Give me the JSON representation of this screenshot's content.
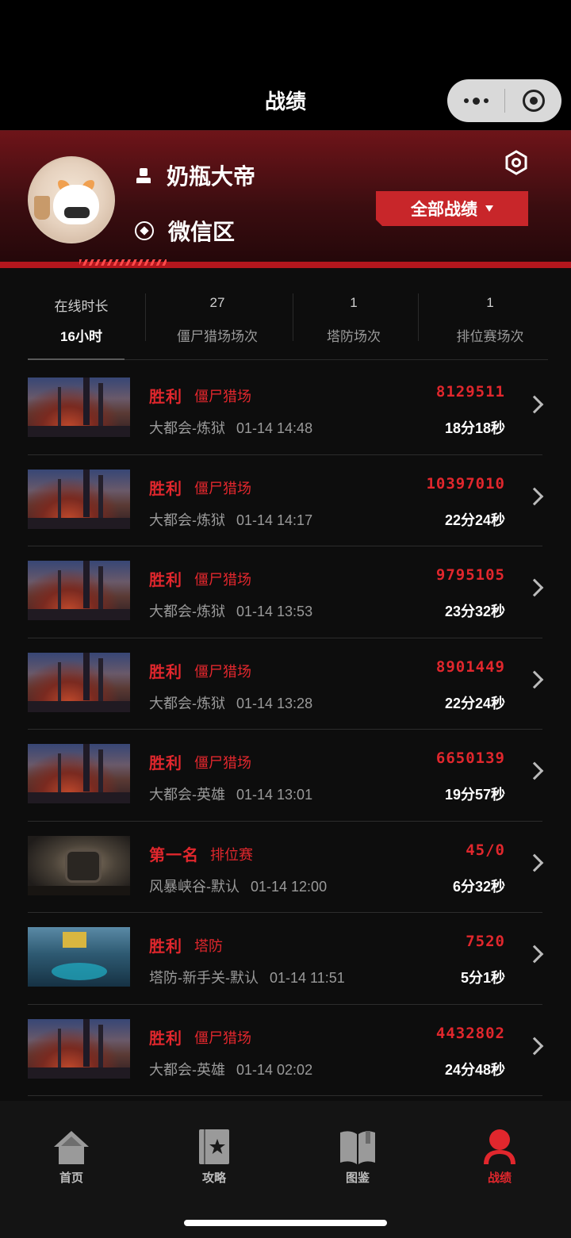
{
  "nav": {
    "title": "战绩",
    "more_icon": "more-dots-icon",
    "close_icon": "mini-program-close-icon"
  },
  "profile": {
    "name": "奶瓶大帝",
    "zone": "微信区",
    "user_icon": "user-icon",
    "zone_icon": "target-icon",
    "settings_icon": "hexagon-settings-icon",
    "filter_label": "全部战绩"
  },
  "stats": [
    {
      "top": "在线时长",
      "bottom": "16小时"
    },
    {
      "top": "27",
      "bottom": "僵尸猎场场次"
    },
    {
      "top": "1",
      "bottom": "塔防场次"
    },
    {
      "top": "1",
      "bottom": "排位赛场次"
    }
  ],
  "matches": [
    {
      "result": "胜利",
      "mode": "僵尸猎场",
      "map": "大都会-炼狱",
      "time": "01-14 14:48",
      "score": "8129511",
      "duration": "18分18秒",
      "thumb": "city"
    },
    {
      "result": "胜利",
      "mode": "僵尸猎场",
      "map": "大都会-炼狱",
      "time": "01-14 14:17",
      "score": "10397010",
      "duration": "22分24秒",
      "thumb": "city"
    },
    {
      "result": "胜利",
      "mode": "僵尸猎场",
      "map": "大都会-炼狱",
      "time": "01-14 13:53",
      "score": "9795105",
      "duration": "23分32秒",
      "thumb": "city"
    },
    {
      "result": "胜利",
      "mode": "僵尸猎场",
      "map": "大都会-炼狱",
      "time": "01-14 13:28",
      "score": "8901449",
      "duration": "22分24秒",
      "thumb": "city"
    },
    {
      "result": "胜利",
      "mode": "僵尸猎场",
      "map": "大都会-英雄",
      "time": "01-14 13:01",
      "score": "6650139",
      "duration": "19分57秒",
      "thumb": "city"
    },
    {
      "result": "第一名",
      "mode": "排位赛",
      "map": "风暴峡谷-默认",
      "time": "01-14 12:00",
      "score": "45/0",
      "duration": "6分32秒",
      "thumb": "mech"
    },
    {
      "result": "胜利",
      "mode": "塔防",
      "map": "塔防-新手关-默认",
      "time": "01-14 11:51",
      "score": "7520",
      "duration": "5分1秒",
      "thumb": "tower"
    },
    {
      "result": "胜利",
      "mode": "僵尸猎场",
      "map": "大都会-英雄",
      "time": "01-14 02:02",
      "score": "4432802",
      "duration": "24分48秒",
      "thumb": "city"
    }
  ],
  "tabs": [
    {
      "label": "首页",
      "icon": "home-icon"
    },
    {
      "label": "攻略",
      "icon": "guide-book-star-icon"
    },
    {
      "label": "图鉴",
      "icon": "open-book-icon"
    },
    {
      "label": "战绩",
      "icon": "profile-person-icon",
      "active": true
    }
  ],
  "colors": {
    "accent": "#e1272d",
    "header_bg": "#6e1419",
    "bg": "#0d0d0d"
  }
}
